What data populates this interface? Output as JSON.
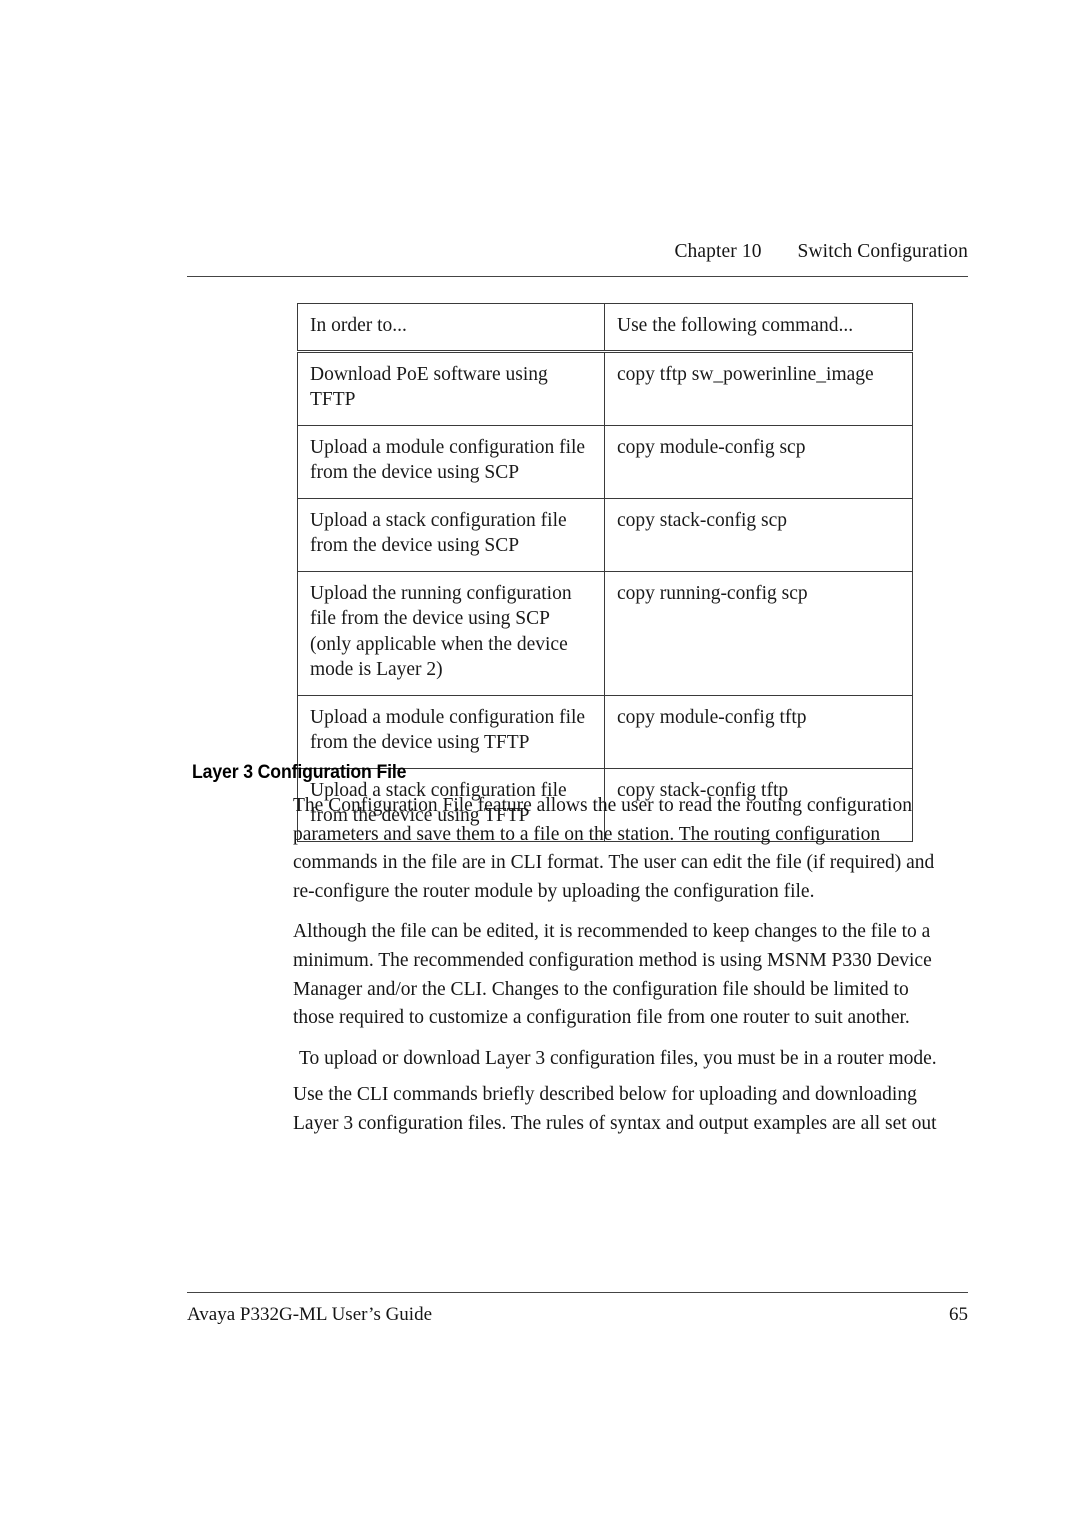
{
  "header": {
    "chapter_label": "Chapter 10",
    "chapter_title": "Switch Configuration"
  },
  "table": {
    "columns": [
      "In order to...",
      "Use the following command..."
    ],
    "rows": [
      {
        "task": "Download PoE software using TFTP",
        "command": "copy tftp sw_powerinline_image"
      },
      {
        "task": "Upload a module configuration file from the device using SCP",
        "command": "copy module-config scp"
      },
      {
        "task": "Upload a stack configuration file from the device using SCP",
        "command": "copy stack-config scp"
      },
      {
        "task": "Upload the running configuration file from the device using SCP (only applicable when the device mode is Layer 2)",
        "command": "copy running-config scp"
      },
      {
        "task": "Upload a module configuration file from the device using TFTP",
        "command": "copy module-config tftp"
      },
      {
        "task": "Upload a stack configuration file from the device using TFTP",
        "command": "copy stack-config tftp"
      }
    ]
  },
  "section": {
    "heading": "Layer 3 Configuration File",
    "paragraphs": [
      "The Configuration File feature allows the user to read the routing configuration parameters and save them to a file on the station. The routing configuration commands in the file are in CLI format. The user can edit the file (if required) and re-configure the router module by uploading the configuration file.",
      "Although the file can be edited, it is recommended to keep changes to the file to a minimum. The recommended configuration method is using MSNM P330 Device Manager and/or the CLI. Changes to the configuration file should be limited to those required to customize a configuration file from one router to suit another.",
      "To upload or download Layer 3 configuration files, you must be in a router mode.",
      "Use the CLI commands briefly described below for uploading and downloading Layer 3 configuration files. The rules of syntax and output examples are all set out"
    ]
  },
  "footer": {
    "guide_title": "Avaya P332G-ML User’s Guide",
    "page_number": "65"
  }
}
